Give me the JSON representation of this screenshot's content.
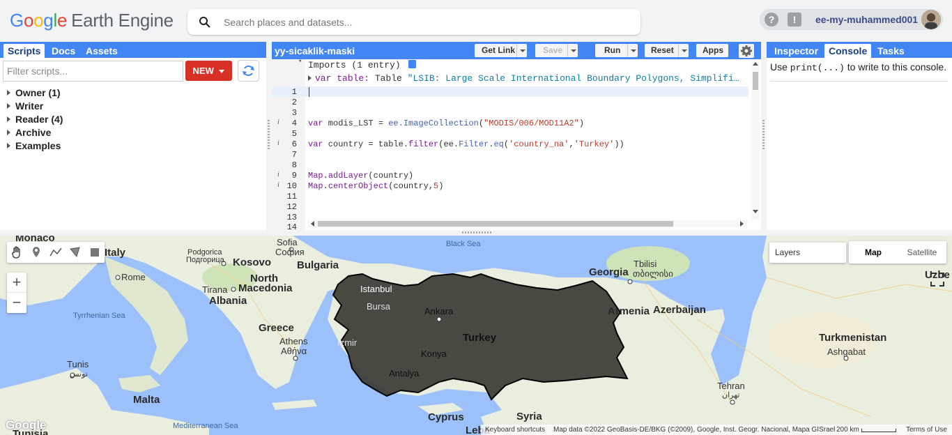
{
  "header": {
    "logo": {
      "google": [
        "G",
        "o",
        "o",
        "g",
        "l",
        "e"
      ],
      "product": "Earth Engine"
    },
    "search": {
      "placeholder": "Search places and datasets..."
    },
    "help_icon": "?",
    "feedback_icon": "!",
    "user": "ee-my-muhammed001"
  },
  "left_panel": {
    "tabs": [
      "Scripts",
      "Docs",
      "Assets"
    ],
    "active_tab": "Scripts",
    "filter_placeholder": "Filter scripts...",
    "new_button": "NEW",
    "tree": [
      "Owner (1)",
      "Writer",
      "Reader (4)",
      "Archive",
      "Examples"
    ]
  },
  "editor": {
    "title": "yy-sicaklik-maski",
    "buttons": {
      "get_link": "Get Link",
      "save": "Save",
      "run": "Run",
      "reset": "Reset",
      "apps": "Apps"
    },
    "imports_header": "Imports (1 entry)",
    "import_var": {
      "keyword": "var",
      "name": "table:",
      "type": "Table",
      "value": "\"LSIB: Large Scale International Boundary Polygons, Simplifi…"
    },
    "line_numbers": [
      "1",
      "2",
      "3",
      "4",
      "5",
      "6",
      "7",
      "8",
      "9",
      "10",
      "11",
      "12",
      "13",
      "14"
    ],
    "code": {
      "l4": {
        "a": "var",
        "b": " modis_LST = ",
        "c": "ee.ImageCollection",
        "d": "(",
        "e": "\"MODIS/006/MOD11A2\"",
        "f": ")"
      },
      "l6": {
        "a": "var",
        "b": " country = table.",
        "c": "filter",
        "d": "(ee.",
        "e": "Filter",
        "f": ".",
        "g": "eq",
        "h": "(",
        "i": "'country_na'",
        "j": ",",
        "k": "'Turkey'",
        "l": "))"
      },
      "l9": {
        "a": "Map",
        "b": ".",
        "c": "addLayer",
        "d": "(country)"
      },
      "l10": {
        "a": "Map",
        "b": ".",
        "c": "centerObject",
        "d": "(country,",
        "e": "5",
        "f": ")"
      }
    }
  },
  "right_panel": {
    "tabs": [
      "Inspector",
      "Console",
      "Tasks"
    ],
    "active_tab": "Console",
    "hint_prefix": "Use ",
    "hint_code": "print(...)",
    "hint_suffix": " to write to this console."
  },
  "map": {
    "controls": {
      "zoom_in": "+",
      "zoom_out": "−",
      "layers": "Layers",
      "map": "Map",
      "satellite": "Satellite"
    },
    "labels": {
      "monaco": "Monaco",
      "italy": "Italy",
      "rome": "Rome",
      "tyrrhenian": "Tyrrhenian Sea",
      "tunis": "Tunis",
      "tunis_ar": "تونس",
      "malta": "Malta",
      "med": "Mediterranean Sea",
      "tunisia": "Tunisia",
      "sofia": "Sofia",
      "sofia_bg": "София",
      "podgorica": "Podgorica",
      "podgorica_sr": "Подгорица",
      "kosovo": "Kosovo",
      "bulgaria": "Bulgaria",
      "tirana": "Tirana",
      "north": "North",
      "macedonia": "Macedonia",
      "albania": "Albania",
      "greece": "Greece",
      "athens": "Athens",
      "athens_gr": "Αθήνα",
      "black_sea": "Black Sea",
      "istanbul": "Istanbul",
      "bursa": "Bursa",
      "ankara": "Ankara",
      "turkey": "Turkey",
      "izmir": "İzmir",
      "konya": "Konya",
      "antalya": "Antalya",
      "cyprus": "Cyprus",
      "syria": "Syria",
      "lebanon": "Leba",
      "georgia": "Georgia",
      "tbilisi": "Tbilisi",
      "tbilisi_ka": "თბილისი",
      "armenia": "Armenia",
      "azerbaijan": "Azerbaijan",
      "turkmenistan": "Turkmenistan",
      "ashgabat": "Ashgabat",
      "tehran": "Tehran",
      "tehran_fa": "تهران",
      "uzbek": "Uzbe"
    },
    "google_logo": "Google",
    "attribution": {
      "shortcuts": "Keyboard shortcuts",
      "data": "Map data ©2022 GeoBasis-DE/BKG (©2009), Google, Inst. Geogr. Nacional, Mapa GISrael",
      "scale": "200 km",
      "terms": "Terms of Use"
    }
  },
  "colors": {
    "blue_bar": "#4285f4",
    "new_button": "#d93025",
    "turkey_fill": "#3b3d35",
    "sea": "#9cc0f9",
    "land": "#e9eedf"
  }
}
